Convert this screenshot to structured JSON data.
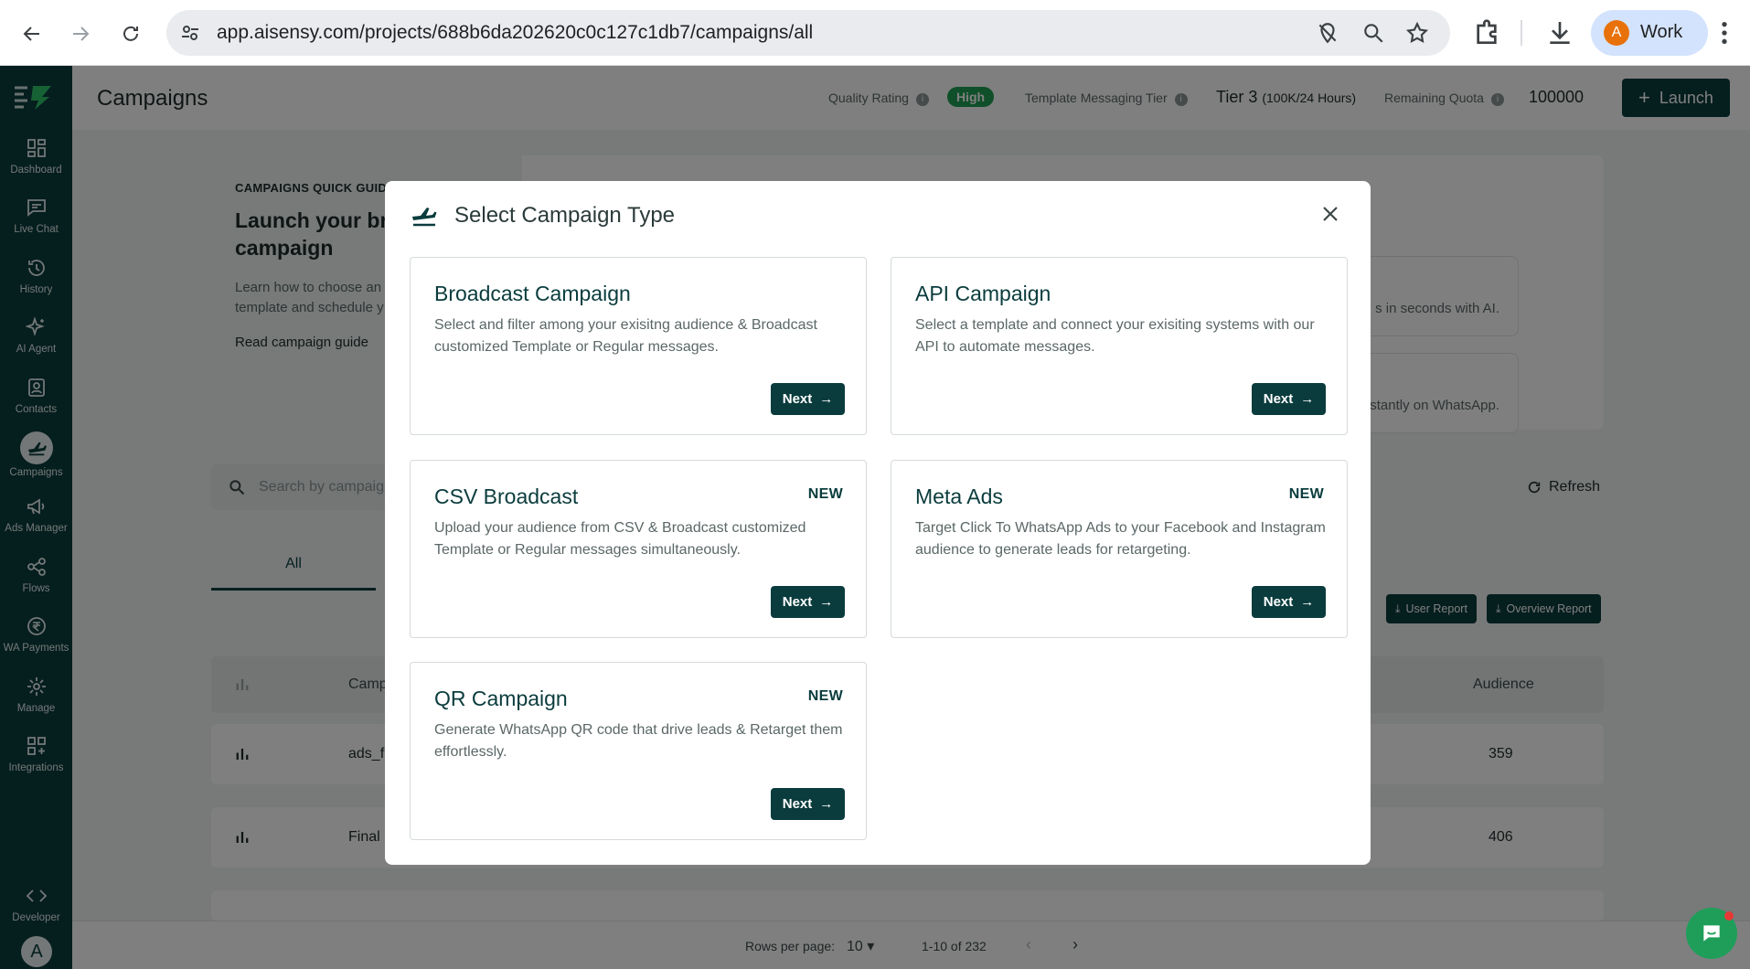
{
  "browser": {
    "url": "app.aisensy.com/projects/688b6da202620c0c127c1db7/campaigns/all",
    "profile_initial": "A",
    "profile_name": "Work"
  },
  "sidebar": {
    "items": [
      {
        "label": "Dashboard",
        "icon": "dashboard-icon"
      },
      {
        "label": "Live Chat",
        "icon": "chat-icon"
      },
      {
        "label": "History",
        "icon": "history-icon"
      },
      {
        "label": "AI Agent",
        "icon": "sparkle-icon"
      },
      {
        "label": "Contacts",
        "icon": "contacts-icon"
      },
      {
        "label": "Campaigns",
        "icon": "plane-icon"
      },
      {
        "label": "Ads Manager",
        "icon": "megaphone-icon"
      },
      {
        "label": "Flows",
        "icon": "flows-icon"
      },
      {
        "label": "WA Payments",
        "icon": "rupee-icon"
      },
      {
        "label": "Manage",
        "icon": "gear-icon"
      },
      {
        "label": "Integrations",
        "icon": "integrations-icon"
      }
    ],
    "developer": "Developer",
    "avatar": "A"
  },
  "topbar": {
    "title": "Campaigns",
    "quality_label": "Quality Rating",
    "quality_value": "High",
    "tier_label": "Template Messaging Tier",
    "tier_value": "Tier 3",
    "tier_sub": "(100K/24 Hours)",
    "quota_label": "Remaining Quota",
    "quota_value": "100000",
    "launch": "Launch"
  },
  "guide": {
    "tag": "CAMPAIGNS QUICK GUIDE",
    "heading": "Launch your br… campaign",
    "heading_line1": "Launch your br",
    "heading_line2": "campaign",
    "para_line1": "Learn how to choose an",
    "para_line2": "template and schedule y",
    "link": "Read campaign guide",
    "ai_card1": "s in seconds with AI.",
    "ai_card2": "o instantly on WhatsApp."
  },
  "list": {
    "search_placeholder": "Search by campaig",
    "refresh": "Refresh",
    "tab_all": "All",
    "user_report": "User Report",
    "overview_report": "Overview Report",
    "col_campaign": "Camp",
    "col_audience": "Audience",
    "rows": [
      {
        "name": "ads_f",
        "audience": "359"
      },
      {
        "name": "Final",
        "audience": "406"
      }
    ]
  },
  "pager": {
    "rows_label": "Rows per page:",
    "rows_value": "10",
    "range": "1-10 of 232"
  },
  "modal": {
    "title": "Select Campaign Type",
    "cards": [
      {
        "title": "Broadcast Campaign",
        "desc": "Select and filter among your exisitng audience & Broadcast customized Template or Regular messages.",
        "new": "",
        "next": "Next"
      },
      {
        "title": "API Campaign",
        "desc": "Select a template and connect your exisiting systems with our API to automate messages.",
        "new": "",
        "next": "Next"
      },
      {
        "title": "CSV Broadcast",
        "desc": "Upload your audience from CSV & Broadcast customized Template or Regular messages simultaneously.",
        "new": "NEW",
        "next": "Next"
      },
      {
        "title": "Meta Ads",
        "desc": "Target Click To WhatsApp Ads to your Facebook and Instagram audience to generate leads for retargeting.",
        "new": "NEW",
        "next": "Next"
      },
      {
        "title": "QR Campaign",
        "desc": "Generate WhatsApp QR code that drive leads & Retarget them effortlessly.",
        "new": "NEW",
        "next": "Next"
      }
    ]
  },
  "colors": {
    "brand": "#0b3c3d",
    "success": "#1e9e52"
  }
}
